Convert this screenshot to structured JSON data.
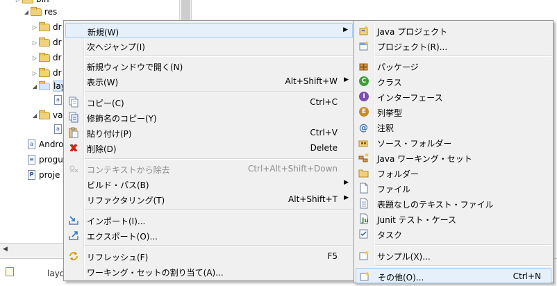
{
  "tree": {
    "items": [
      {
        "label": "bin",
        "kind": "folder",
        "expanded": false
      },
      {
        "label": "res",
        "kind": "folder",
        "expanded": true
      },
      {
        "label": "dr",
        "kind": "folder",
        "expanded": false
      },
      {
        "label": "dr",
        "kind": "folder",
        "expanded": false
      },
      {
        "label": "dr",
        "kind": "folder",
        "expanded": false
      },
      {
        "label": "dr",
        "kind": "folder",
        "expanded": false
      },
      {
        "label": "lay",
        "kind": "folder",
        "expanded": true
      },
      {
        "label": "",
        "kind": "file",
        "expanded": false
      },
      {
        "label": "va",
        "kind": "folder",
        "expanded": true
      },
      {
        "label": "",
        "kind": "file",
        "expanded": false
      },
      {
        "label": "Andro",
        "kind": "file",
        "expanded": false
      },
      {
        "label": "progu",
        "kind": "file",
        "expanded": false
      },
      {
        "label": "proje",
        "kind": "file",
        "expanded": false
      }
    ]
  },
  "bottom_panel": {
    "label": "layo"
  },
  "context_menu": {
    "items": [
      {
        "label": "新規(W)",
        "shortcut": "",
        "submenu": true,
        "icon": "",
        "disabled": false,
        "highlighted": true
      },
      {
        "label": "次へジャンプ(I)",
        "shortcut": "",
        "submenu": false,
        "icon": "",
        "disabled": false
      },
      {
        "label": "新規ウィンドウで開く(N)",
        "shortcut": "",
        "submenu": false,
        "icon": "",
        "disabled": false
      },
      {
        "label": "表示(W)",
        "shortcut": "Alt+Shift+W",
        "submenu": true,
        "icon": "",
        "disabled": false
      },
      {
        "label": "コピー(C)",
        "shortcut": "Ctrl+C",
        "submenu": false,
        "icon": "copy-icon",
        "disabled": false
      },
      {
        "label": "修飾名のコピー(Y)",
        "shortcut": "",
        "submenu": false,
        "icon": "copy-qualified-icon",
        "disabled": false
      },
      {
        "label": "貼り付け(P)",
        "shortcut": "Ctrl+V",
        "submenu": false,
        "icon": "paste-icon",
        "disabled": false
      },
      {
        "label": "削除(D)",
        "shortcut": "Delete",
        "submenu": false,
        "icon": "delete-icon",
        "disabled": false
      },
      {
        "label": "コンテキストから除去",
        "shortcut": "Ctrl+Alt+Shift+Down",
        "submenu": false,
        "icon": "remove-context-icon",
        "disabled": true
      },
      {
        "label": "ビルド・パス(B)",
        "shortcut": "",
        "submenu": true,
        "icon": "",
        "disabled": false
      },
      {
        "label": "リファクタリング(T)",
        "shortcut": "Alt+Shift+T",
        "submenu": true,
        "icon": "",
        "disabled": false
      },
      {
        "label": "インポート(I)...",
        "shortcut": "",
        "submenu": false,
        "icon": "import-icon",
        "disabled": false
      },
      {
        "label": "エクスポート(O)...",
        "shortcut": "",
        "submenu": false,
        "icon": "export-icon",
        "disabled": false
      },
      {
        "label": "リフレッシュ(F)",
        "shortcut": "F5",
        "submenu": false,
        "icon": "refresh-icon",
        "disabled": false
      },
      {
        "label": "ワーキング・セットの割り当て(A)...",
        "shortcut": "",
        "submenu": false,
        "icon": "",
        "disabled": false
      }
    ]
  },
  "submenu": {
    "items": [
      {
        "label": "Java プロジェクト",
        "shortcut": "",
        "icon": "java-project-icon"
      },
      {
        "label": "プロジェクト(R)...",
        "shortcut": "",
        "icon": "project-icon"
      },
      {
        "label": "パッケージ",
        "shortcut": "",
        "icon": "package-icon"
      },
      {
        "label": "クラス",
        "shortcut": "",
        "icon": "class-icon"
      },
      {
        "label": "インターフェース",
        "shortcut": "",
        "icon": "interface-icon"
      },
      {
        "label": "列挙型",
        "shortcut": "",
        "icon": "enum-icon"
      },
      {
        "label": "注釈",
        "shortcut": "",
        "icon": "annotation-icon"
      },
      {
        "label": "ソース・フォルダー",
        "shortcut": "",
        "icon": "source-folder-icon"
      },
      {
        "label": "Java ワーキング・セット",
        "shortcut": "",
        "icon": "working-set-icon"
      },
      {
        "label": "フォルダー",
        "shortcut": "",
        "icon": "folder-icon"
      },
      {
        "label": "ファイル",
        "shortcut": "",
        "icon": "file-icon"
      },
      {
        "label": "表題なしのテキスト・ファイル",
        "shortcut": "",
        "icon": "text-file-icon"
      },
      {
        "label": "Junit テスト・ケース",
        "shortcut": "",
        "icon": "junit-icon"
      },
      {
        "label": "タスク",
        "shortcut": "",
        "icon": "task-icon"
      },
      {
        "label": "サンプル(X)...",
        "shortcut": "",
        "icon": "sample-icon"
      },
      {
        "label": "その他(O)...",
        "shortcut": "Ctrl+N",
        "icon": "other-icon",
        "highlighted": true
      }
    ]
  },
  "colors": {
    "menu_bg": "#f0f0f0",
    "highlight_bg": "#e5f0fb",
    "highlight_border": "#a8d0f2",
    "disabled_text": "#8d8d8d",
    "folder": "#f1d27c",
    "delete_red": "#d9261c"
  }
}
